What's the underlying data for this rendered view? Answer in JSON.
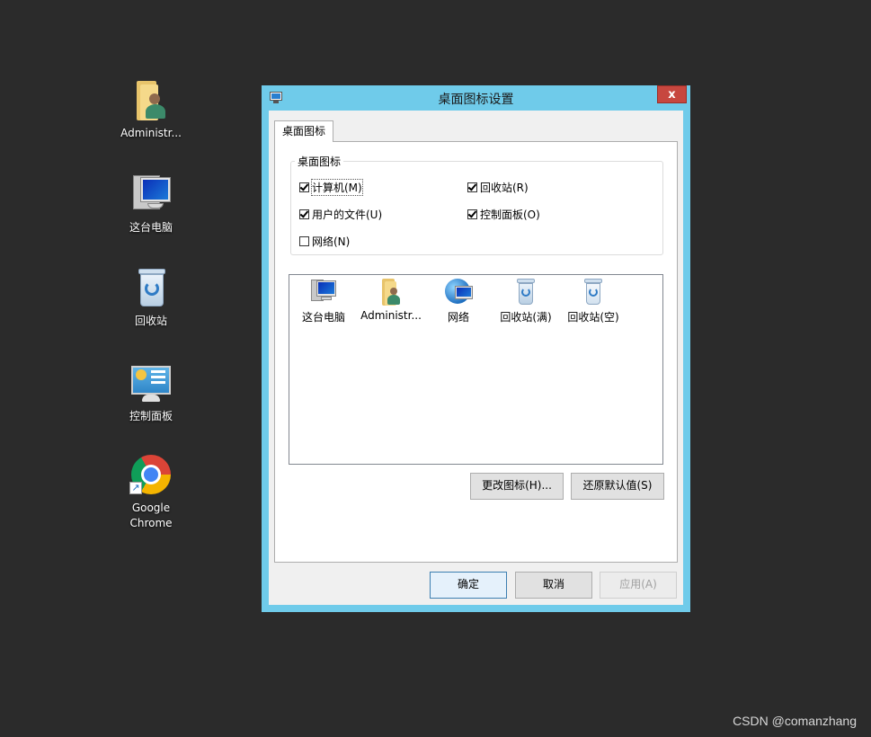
{
  "desktop": {
    "icons": [
      {
        "label": "Administr...",
        "icon": "user-folder-icon"
      },
      {
        "label": "这台电脑",
        "icon": "computer-icon"
      },
      {
        "label": "回收站",
        "icon": "recycle-bin-icon"
      },
      {
        "label": "控制面板",
        "icon": "control-panel-icon"
      },
      {
        "label": "Google Chrome",
        "icon": "chrome-icon"
      }
    ],
    "watermark": "CSDN @comanzhang"
  },
  "dialog": {
    "title": "桌面图标设置",
    "close_symbol": "x",
    "tab_label": "桌面图标",
    "group_label": "桌面图标",
    "checkboxes": [
      {
        "label": "计算机(M)",
        "checked": true
      },
      {
        "label": "回收站(R)",
        "checked": true
      },
      {
        "label": "用户的文件(U)",
        "checked": true
      },
      {
        "label": "控制面板(O)",
        "checked": true
      },
      {
        "label": "网络(N)",
        "checked": false
      }
    ],
    "icon_list": [
      {
        "label": "这台电脑",
        "icon": "computer-icon"
      },
      {
        "label": "Administr...",
        "icon": "user-folder-icon"
      },
      {
        "label": "网络",
        "icon": "network-icon"
      },
      {
        "label": "回收站(满)",
        "icon": "recycle-bin-full-icon"
      },
      {
        "label": "回收站(空)",
        "icon": "recycle-bin-empty-icon"
      }
    ],
    "change_icon_button": "更改图标(H)...",
    "restore_default_button": "还原默认值(S)",
    "ok_button": "确定",
    "cancel_button": "取消",
    "apply_button": "应用(A)"
  }
}
